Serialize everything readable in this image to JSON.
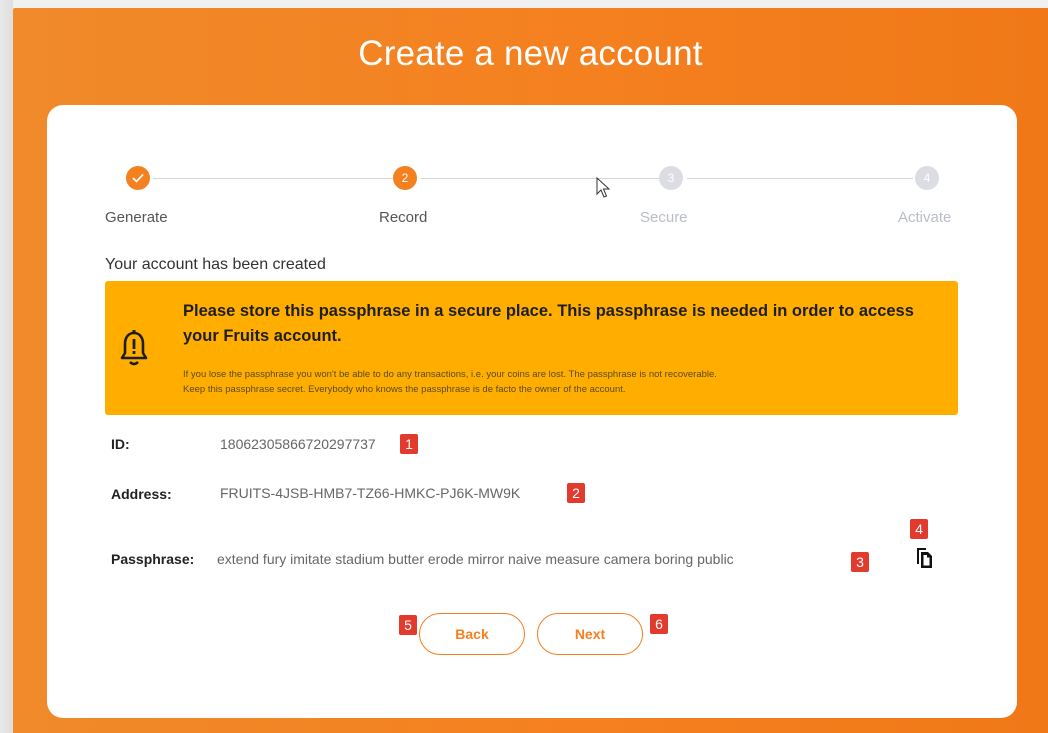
{
  "page": {
    "title": "Create a new account"
  },
  "stepper": {
    "steps": [
      {
        "number": "1",
        "label": "Generate",
        "state": "done"
      },
      {
        "number": "2",
        "label": "Record",
        "state": "active"
      },
      {
        "number": "3",
        "label": "Secure",
        "state": "inactive"
      },
      {
        "number": "4",
        "label": "Activate",
        "state": "inactive"
      }
    ],
    "done_icon": "check-icon"
  },
  "status": {
    "message": "Your account has been created"
  },
  "notice": {
    "icon": "bell-alert-icon",
    "heading": "Please store this passphrase in a secure place. This passphrase is needed in order to access your Fruits account.",
    "line1": "If you lose the passphrase you won't be able to do any transactions, i.e. your coins are lost. The passphrase is not recoverable.",
    "line2": "Keep this passphrase secret. Everybody who knows the passphrase is de facto the owner of the account."
  },
  "account": {
    "id_label": "ID:",
    "id_value": "18062305866720297737",
    "address_label": "Address:",
    "address_value": "FRUITS-4JSB-HMB7-TZ66-HMKC-PJ6K-MW9K",
    "passphrase_label": "Passphrase:",
    "passphrase_value": "extend fury imitate stadium butter erode mirror naive measure camera boring public",
    "copy_icon": "copy-icon"
  },
  "markers": [
    "1",
    "2",
    "3",
    "4",
    "5",
    "6"
  ],
  "buttons": {
    "back": "Back",
    "next": "Next"
  },
  "colors": {
    "accent": "#f5801f",
    "warning": "#ffae00",
    "marker": "#e23b2e"
  }
}
